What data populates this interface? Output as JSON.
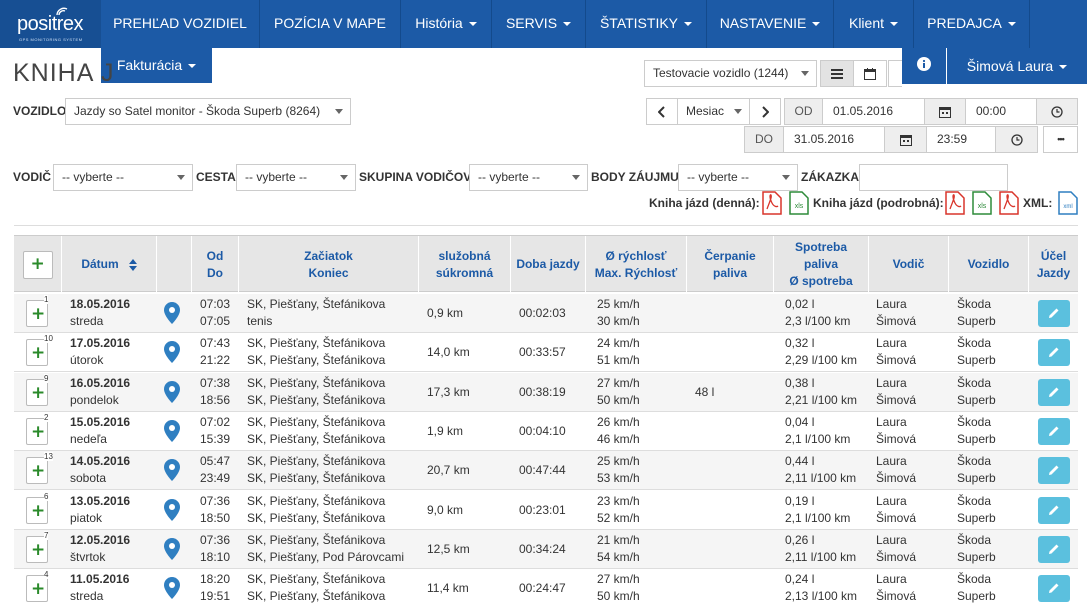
{
  "brand": {
    "name": "positrex",
    "tagline": "GPS MONITORING SYSTEM"
  },
  "nav": {
    "items": [
      {
        "label": "PREHĽAD VOZIDIEL",
        "dropdown": false
      },
      {
        "label": "POZÍCIA V MAPE",
        "dropdown": false
      },
      {
        "label": "História",
        "dropdown": true
      },
      {
        "label": "SERVIS",
        "dropdown": true
      },
      {
        "label": "ŠTATISTIKY",
        "dropdown": true
      },
      {
        "label": "NASTAVENIE",
        "dropdown": true
      },
      {
        "label": "Klient",
        "dropdown": true
      },
      {
        "label": "PREDAJCA",
        "dropdown": true
      }
    ],
    "sub_item": "Fakturácia"
  },
  "page_title": "KNIHA J",
  "user": {
    "name": "Šimová Laura",
    "info_icon": "info-icon"
  },
  "vehicle_select": {
    "value": "Testovacie vozidlo (1244)"
  },
  "filters": {
    "vozidlo_label": "VOZIDLO",
    "vozidlo_value": "Jazdy so Satel monitor - Škoda Superb (8264)",
    "period_value": "Mesiac",
    "od_label": "OD",
    "od_date": "01.05.2016",
    "od_time": "00:00",
    "do_label": "DO",
    "do_date": "31.05.2016",
    "do_time": "23:59",
    "more_label": "•••",
    "vodic_label": "VODIČ",
    "vodic_value": "-- vyberte --",
    "cesta_label": "CESTA",
    "cesta_value": "-- vyberte --",
    "skupina_label": "SKUPINA VODIČOV",
    "skupina_value": "-- vyberte --",
    "body_label": "BODY ZÁUJMU",
    "body_value": "-- vyberte --",
    "zakazka_label": "ZÁKAZKA",
    "zakazka_value": ""
  },
  "exports": {
    "denna_label": "Kniha jázd (denná):",
    "podrobna_label": "Kniha jázd (podrobná):",
    "xml_label": "XML:",
    "pdf_text": "PDF",
    "xls_text": "xls",
    "xml_text": "xml"
  },
  "table": {
    "headers": {
      "add": "+",
      "datum": "Dátum",
      "od_do": [
        "Od",
        "Do"
      ],
      "start_end": [
        "Začiatok",
        "Koniec"
      ],
      "type": [
        "služobná",
        "súkromná"
      ],
      "duration": "Doba jazdy",
      "speed": [
        "Ø rýchlosť",
        "Max. Rýchlosť"
      ],
      "fuel_draw": [
        "Čerpanie",
        "paliva"
      ],
      "consumption": [
        "Spotreba",
        "paliva",
        "Ø spotreba"
      ],
      "driver": "Vodič",
      "vehicle": "Vozidlo",
      "purpose": [
        "Účel",
        "Jazdy"
      ]
    },
    "rows": [
      {
        "count": "1",
        "date": "18.05.2016",
        "day": "streda",
        "from": "07:03",
        "to": "07:05",
        "start": "SK, Piešťany, Štefánikova",
        "end": "tenis",
        "distance": "0,9 km",
        "duration": "00:02:03",
        "avg_speed": "25 km/h",
        "max_speed": "30 km/h",
        "fuel": "",
        "fuel_used": "0,02 l",
        "avg_cons": "2,3 l/100 km",
        "driver1": "Laura",
        "driver2": "Šimová",
        "veh1": "Škoda",
        "veh2": "Superb"
      },
      {
        "count": "10",
        "date": "17.05.2016",
        "day": "útorok",
        "from": "07:43",
        "to": "21:22",
        "start": "SK, Piešťany, Štefánikova",
        "end": "SK, Piešťany, Štefánikova",
        "distance": "14,0 km",
        "duration": "00:33:57",
        "avg_speed": "24 km/h",
        "max_speed": "51 km/h",
        "fuel": "",
        "fuel_used": "0,32 l",
        "avg_cons": "2,29 l/100 km",
        "driver1": "Laura",
        "driver2": "Šimová",
        "veh1": "Škoda",
        "veh2": "Superb"
      },
      {
        "count": "9",
        "date": "16.05.2016",
        "day": "pondelok",
        "from": "07:38",
        "to": "18:56",
        "start": "SK, Piešťany, Štefánikova",
        "end": "SK, Piešťany, Štefánikova",
        "distance": "17,3 km",
        "duration": "00:38:19",
        "avg_speed": "27 km/h",
        "max_speed": "50 km/h",
        "fuel": "48 l",
        "fuel_used": "0,38 l",
        "avg_cons": "2,21 l/100 km",
        "driver1": "Laura",
        "driver2": "Šimová",
        "veh1": "Škoda",
        "veh2": "Superb"
      },
      {
        "count": "2",
        "date": "15.05.2016",
        "day": "nedeľa",
        "from": "07:02",
        "to": "15:39",
        "start": "SK, Piešťany, Štefánikova",
        "end": "SK, Piešťany, Štefánikova",
        "distance": "1,9 km",
        "duration": "00:04:10",
        "avg_speed": "26 km/h",
        "max_speed": "46 km/h",
        "fuel": "",
        "fuel_used": "0,04 l",
        "avg_cons": "2,1 l/100 km",
        "driver1": "Laura",
        "driver2": "Šimová",
        "veh1": "Škoda",
        "veh2": "Superb"
      },
      {
        "count": "13",
        "date": "14.05.2016",
        "day": "sobota",
        "from": "05:47",
        "to": "23:49",
        "start": "SK, Piešťany, Štefánikova",
        "end": "SK, Piešťany, Štefánikova",
        "distance": "20,7 km",
        "duration": "00:47:44",
        "avg_speed": "25 km/h",
        "max_speed": "53 km/h",
        "fuel": "",
        "fuel_used": "0,44 l",
        "avg_cons": "2,11 l/100 km",
        "driver1": "Laura",
        "driver2": "Šimová",
        "veh1": "Škoda",
        "veh2": "Superb"
      },
      {
        "count": "6",
        "date": "13.05.2016",
        "day": "piatok",
        "from": "07:36",
        "to": "18:50",
        "start": "SK, Piešťany, Štefánikova",
        "end": "SK, Piešťany, Štefánikova",
        "distance": "9,0 km",
        "duration": "00:23:01",
        "avg_speed": "23 km/h",
        "max_speed": "52 km/h",
        "fuel": "",
        "fuel_used": "0,19 l",
        "avg_cons": "2,1 l/100 km",
        "driver1": "Laura",
        "driver2": "Šimová",
        "veh1": "Škoda",
        "veh2": "Superb"
      },
      {
        "count": "7",
        "date": "12.05.2016",
        "day": "štvrtok",
        "from": "07:36",
        "to": "18:10",
        "start": "SK, Piešťany, Štefánikova",
        "end": "SK, Piešťany, Pod Párovcami",
        "distance": "12,5 km",
        "duration": "00:34:24",
        "avg_speed": "21 km/h",
        "max_speed": "54 km/h",
        "fuel": "",
        "fuel_used": "0,26 l",
        "avg_cons": "2,11 l/100 km",
        "driver1": "Laura",
        "driver2": "Šimová",
        "veh1": "Škoda",
        "veh2": "Superb"
      },
      {
        "count": "4",
        "date": "11.05.2016",
        "day": "streda",
        "from": "18:20",
        "to": "19:51",
        "start": "SK, Piešťany, Štefánikova",
        "end": "SK, Piešťany, Štefánikova",
        "distance": "11,4 km",
        "duration": "00:24:47",
        "avg_speed": "27 km/h",
        "max_speed": "50 km/h",
        "fuel": "",
        "fuel_used": "0,24 l",
        "avg_cons": "2,13 l/100 km",
        "driver1": "Laura",
        "driver2": "Šimová",
        "veh1": "Škoda",
        "veh2": "Superb"
      }
    ]
  },
  "colors": {
    "nav": "#1c5aa6",
    "accent_info": "#5bc0de",
    "add_green": "#2a8a2a",
    "pdf_red": "#d9352b",
    "xls_green": "#2e8b3a",
    "xml_blue": "#2f7fc1"
  }
}
